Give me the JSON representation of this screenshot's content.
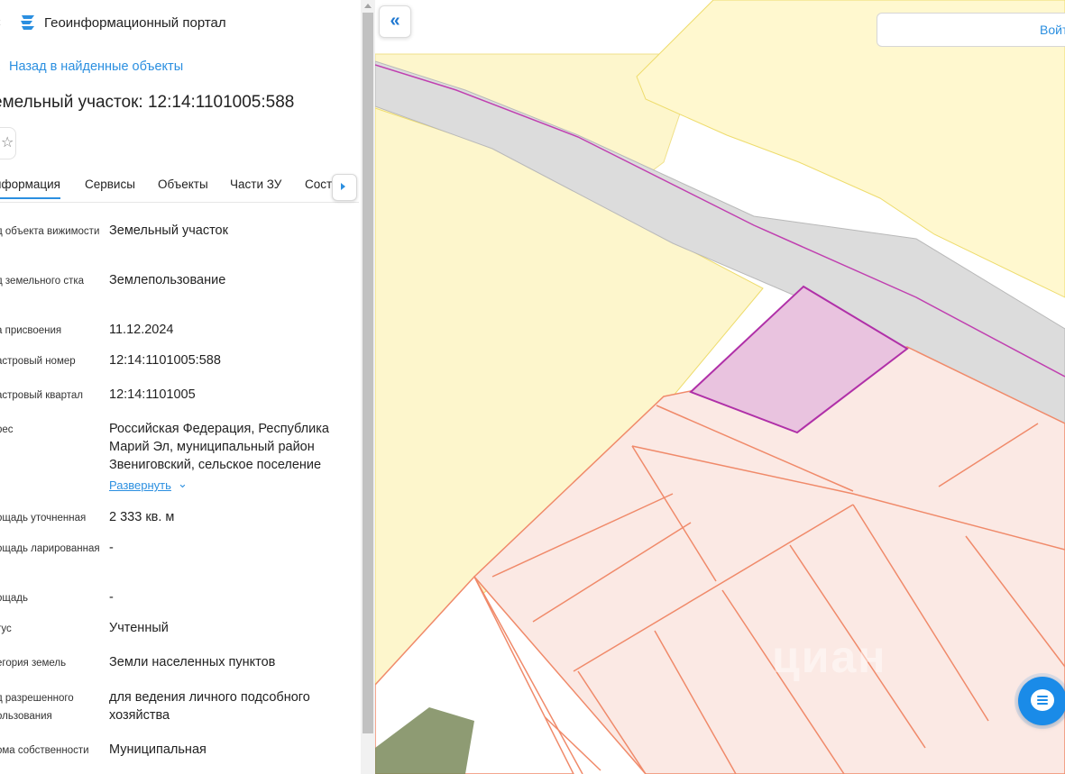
{
  "header": {
    "portal_title": "Геоинформационный портал",
    "menu_icon": "menu-icon",
    "logo_icon": "portal-logo-icon"
  },
  "back_link": "Назад в найденные объекты",
  "object_title": "емельный участок: 12:14:1101005:588",
  "tabs": [
    {
      "label": "нформация",
      "active": true
    },
    {
      "label": "Сервисы",
      "active": false
    },
    {
      "label": "Объекты",
      "active": false
    },
    {
      "label": "Части ЗУ",
      "active": false
    },
    {
      "label": "Состав",
      "active": false
    }
  ],
  "properties": [
    {
      "label": "д объекта вижимости",
      "value": "Земельный участок"
    },
    {
      "label": "д земельного стка",
      "value": "Землепользование"
    },
    {
      "label": "а присвоения",
      "value": "11.12.2024"
    },
    {
      "label": "астровый номер",
      "value": "12:14:1101005:588"
    },
    {
      "label": "астровый квартал",
      "value": "12:14:1101005"
    },
    {
      "label": "рес",
      "value": "Российская Федерация, Республика Марий Эл, муниципальный район Звениговский, сельское поселение"
    },
    {
      "label": "ощадь уточненная",
      "value": "2 333 кв. м"
    },
    {
      "label": "ощадь ларированная",
      "value": "-"
    },
    {
      "label": "ощадь",
      "value": "-"
    },
    {
      "label": "тус",
      "value": "Учтенный"
    },
    {
      "label": "егория земель",
      "value": "Земли населенных пунктов"
    },
    {
      "label": "д разрешенного ользования",
      "value": "для ведения личного подсобного хозяйства"
    },
    {
      "label": "ома собственности",
      "value": "Муниципальная"
    }
  ],
  "expand_link": "Развернуть",
  "map": {
    "login_label": "Войт",
    "watermark": "циан",
    "colors": {
      "yellow_zone": "#fdf6cc",
      "road": "#dcdcdc",
      "parcel_fill": "#fbe9e4",
      "parcel_line": "#f08a6a",
      "selected_fill": "#e9c3df",
      "selected_line": "#b030a8",
      "accent": "#2b8fe0"
    }
  }
}
